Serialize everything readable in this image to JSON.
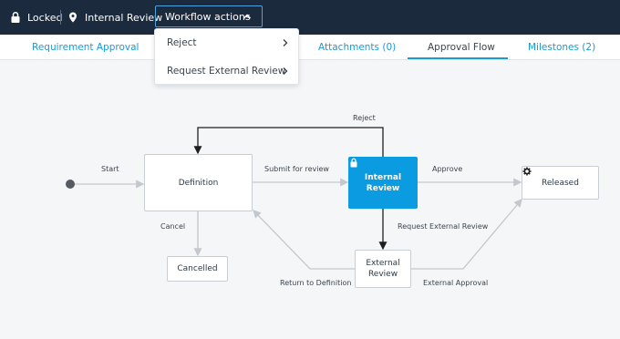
{
  "header": {
    "status_locked": "Locked",
    "status_review": "Internal Review",
    "workflow_actions_label": "Workflow actions",
    "bg_color": "#1b2a3d",
    "accent_color": "#1a9ad6"
  },
  "tabs": [
    {
      "label": "Requirement Approval",
      "active": false
    },
    {
      "label": "Attachments (0)",
      "active": false
    },
    {
      "label": "Approval Flow",
      "active": true
    },
    {
      "label": "Milestones (2)",
      "active": false
    }
  ],
  "menu": {
    "items": [
      {
        "label": "Reject"
      },
      {
        "label": "Request External Review"
      }
    ]
  },
  "diagram": {
    "nodes": {
      "definition": "Definition",
      "internal_review_line1": "Internal",
      "internal_review_line2": "Review",
      "released": "Released",
      "cancelled": "Cancelled",
      "external_review_line1": "External",
      "external_review_line2": "Review"
    },
    "edges": {
      "start": "Start",
      "submit_for_review": "Submit for review",
      "approve": "Approve",
      "reject": "Reject",
      "cancel": "Cancel",
      "request_external_review": "Request External Review",
      "return_to_definition": "Return to Definition",
      "external_approval": "External Approval"
    },
    "active_color": "#0a9be0"
  }
}
